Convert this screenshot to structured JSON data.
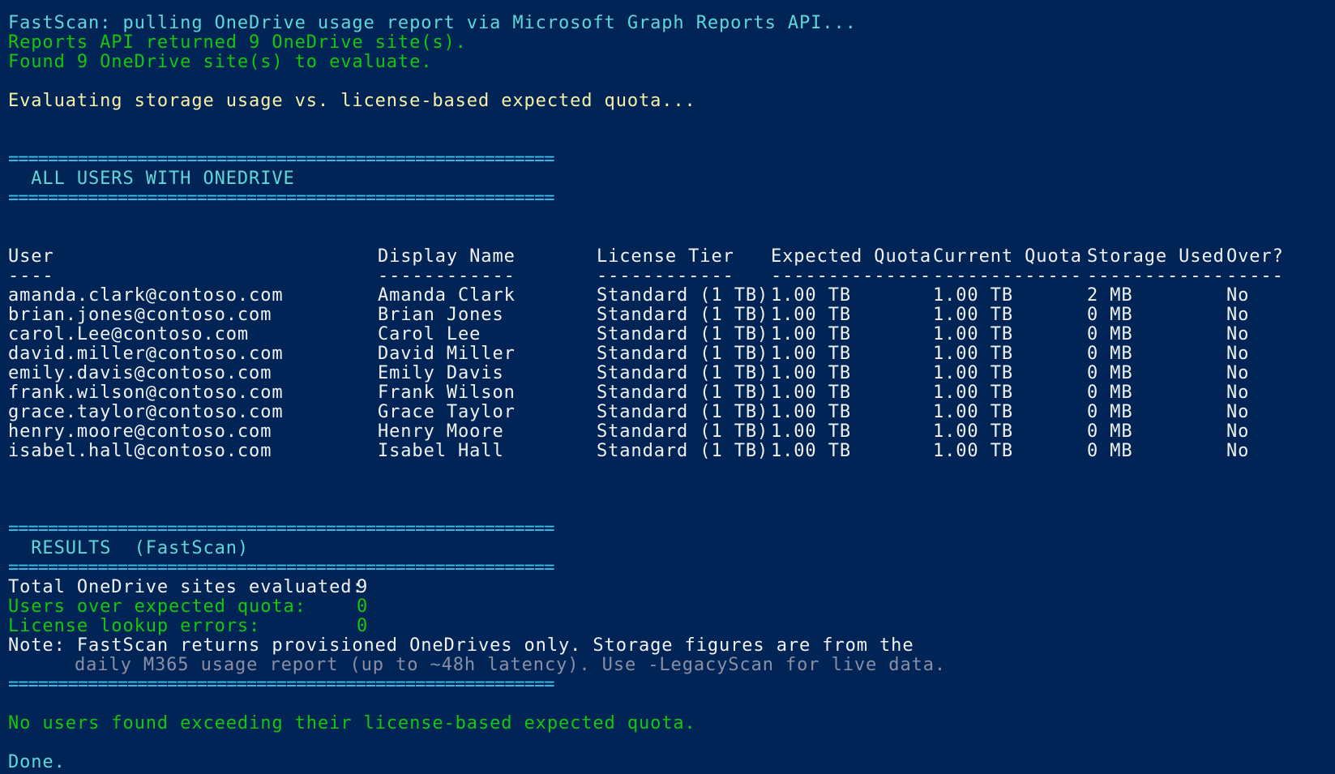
{
  "log": {
    "fastscan_line": "FastScan: pulling OneDrive usage report via Microsoft Graph Reports API...",
    "reports_returned": "Reports API returned 9 OneDrive site(s).",
    "found_sites": "Found 9 OneDrive site(s) to evaluate.",
    "evaluating": "Evaluating storage usage vs. license-based expected quota..."
  },
  "separator": "=======================================================",
  "all_users_header": "  ALL USERS WITH ONEDRIVE",
  "table": {
    "headers": [
      "User",
      "Display Name",
      "License Tier",
      "Expected Quota",
      "Current Quota",
      "Storage Used",
      "Over?"
    ],
    "underlines": [
      "----",
      "------------",
      "------------",
      "--------------",
      "-------------",
      "------------",
      "-----"
    ],
    "rows": [
      [
        "amanda.clark@contoso.com",
        "Amanda Clark",
        "Standard (1 TB)",
        "1.00 TB",
        "1.00 TB",
        "2 MB",
        "No"
      ],
      [
        "brian.jones@contoso.com",
        "Brian Jones",
        "Standard (1 TB)",
        "1.00 TB",
        "1.00 TB",
        "0 MB",
        "No"
      ],
      [
        "carol.Lee@contoso.com",
        "Carol Lee",
        "Standard (1 TB)",
        "1.00 TB",
        "1.00 TB",
        "0 MB",
        "No"
      ],
      [
        "david.miller@contoso.com",
        "David Miller",
        "Standard (1 TB)",
        "1.00 TB",
        "1.00 TB",
        "0 MB",
        "No"
      ],
      [
        "emily.davis@contoso.com",
        "Emily Davis",
        "Standard (1 TB)",
        "1.00 TB",
        "1.00 TB",
        "0 MB",
        "No"
      ],
      [
        "frank.wilson@contoso.com",
        "Frank Wilson",
        "Standard (1 TB)",
        "1.00 TB",
        "1.00 TB",
        "0 MB",
        "No"
      ],
      [
        "grace.taylor@contoso.com",
        "Grace Taylor",
        "Standard (1 TB)",
        "1.00 TB",
        "1.00 TB",
        "0 MB",
        "No"
      ],
      [
        "henry.moore@contoso.com",
        "Henry Moore",
        "Standard (1 TB)",
        "1.00 TB",
        "1.00 TB",
        "0 MB",
        "No"
      ],
      [
        "isabel.hall@contoso.com",
        "Isabel Hall",
        "Standard (1 TB)",
        "1.00 TB",
        "1.00 TB",
        "0 MB",
        "No"
      ]
    ]
  },
  "results_header": "  RESULTS  (FastScan)",
  "results": {
    "total_label": "Total OneDrive sites evaluated:",
    "total_value": "9",
    "over_label": "Users over expected quota:",
    "over_value": "0",
    "errors_label": "License lookup errors:",
    "errors_value": "0",
    "note_line1": "Note: FastScan returns provisioned OneDrives only. Storage figures are from the",
    "note_line2": "daily M365 usage report (up to ~48h latency). Use -LegacyScan for live data."
  },
  "summary": "No users found exceeding their license-based expected quota.",
  "done": "Done.",
  "colors": {
    "background": "#012456",
    "cyan": "#61d6d6",
    "green": "#16c60c",
    "yellow": "#f9f1a5",
    "white": "#f2f2f2",
    "gray": "#8a8fa3"
  }
}
